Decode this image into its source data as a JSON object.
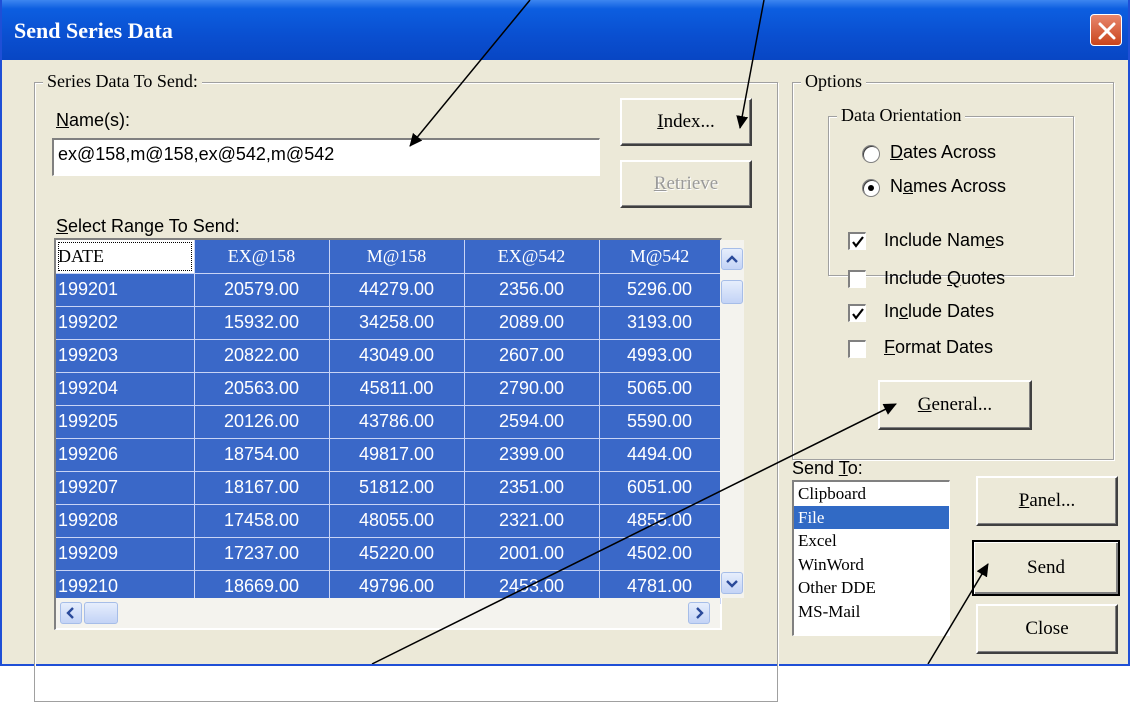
{
  "window": {
    "title": "Send Series Data"
  },
  "series_group": {
    "legend": "Series Data To Send:",
    "names_label_u": "N",
    "names_label_rest": "ame(s):",
    "names_value": "ex@158,m@158,ex@542,m@542",
    "index_u": "I",
    "index_rest": "ndex...",
    "retrieve_u": "R",
    "retrieve_rest": "etrieve",
    "range_label_u": "S",
    "range_label_rest": "elect Range To Send:"
  },
  "grid": {
    "headers": [
      "DATE",
      "EX@158",
      "M@158",
      "EX@542",
      "M@542"
    ],
    "rows": [
      [
        "199201",
        "20579.00",
        "44279.00",
        "2356.00",
        "5296.00"
      ],
      [
        "199202",
        "15932.00",
        "34258.00",
        "2089.00",
        "3193.00"
      ],
      [
        "199203",
        "20822.00",
        "43049.00",
        "2607.00",
        "4993.00"
      ],
      [
        "199204",
        "20563.00",
        "45811.00",
        "2790.00",
        "5065.00"
      ],
      [
        "199205",
        "20126.00",
        "43786.00",
        "2594.00",
        "5590.00"
      ],
      [
        "199206",
        "18754.00",
        "49817.00",
        "2399.00",
        "4494.00"
      ],
      [
        "199207",
        "18167.00",
        "51812.00",
        "2351.00",
        "6051.00"
      ],
      [
        "199208",
        "17458.00",
        "48055.00",
        "2321.00",
        "4855.00"
      ],
      [
        "199209",
        "17237.00",
        "45220.00",
        "2001.00",
        "4502.00"
      ],
      [
        "199210",
        "18669.00",
        "49796.00",
        "2453.00",
        "4781.00"
      ]
    ]
  },
  "options_group": {
    "legend": "Options",
    "orientation_legend": "Data Orientation",
    "dates_across_u": "D",
    "dates_across_rest": "ates Across",
    "names_across_pre": "N",
    "names_across_u": "a",
    "names_across_rest": "mes Across",
    "include_names_pre": "Include Nam",
    "include_names_u": "e",
    "include_names_rest": "s",
    "include_quotes_pre": "Include ",
    "include_quotes_u": "Q",
    "include_quotes_rest": "uotes",
    "include_dates_pre": "In",
    "include_dates_u": "c",
    "include_dates_rest": "lude Dates",
    "format_dates_u": "F",
    "format_dates_rest": "ormat Dates",
    "general_u": "G",
    "general_rest": "eneral..."
  },
  "state": {
    "orientation": "Names Across",
    "include_names": true,
    "include_quotes": false,
    "include_dates": true,
    "format_dates": false
  },
  "send_to": {
    "label_pre": "Send ",
    "label_u": "T",
    "label_rest": "o:",
    "items": [
      "Clipboard",
      "File",
      "Excel",
      "WinWord",
      "Other DDE",
      "MS-Mail"
    ],
    "selected": "File"
  },
  "buttons": {
    "panel_u": "P",
    "panel_rest": "anel...",
    "send": "Send",
    "close": "Close"
  },
  "colors": {
    "selection": "#3a68c8",
    "title_bar": "#0a4fd0",
    "face": "#ece9d8"
  }
}
